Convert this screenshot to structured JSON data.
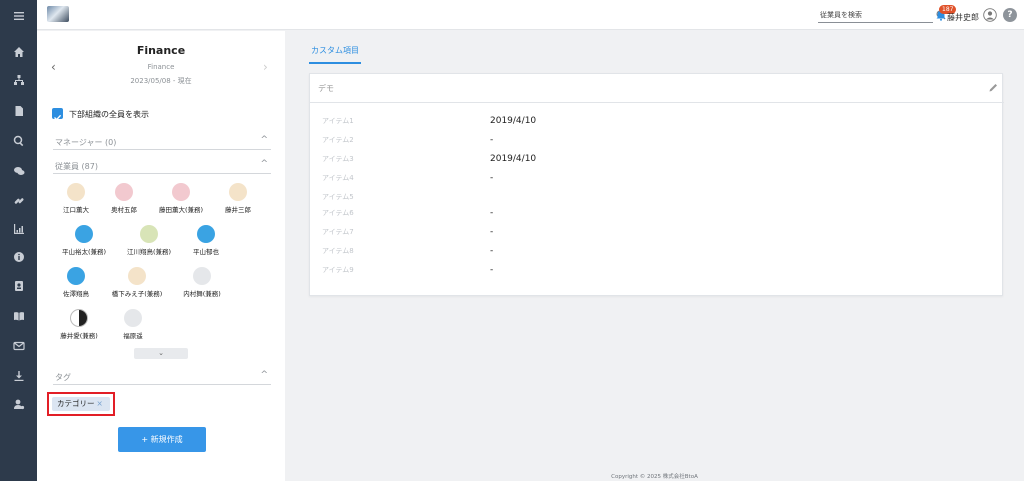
{
  "rail": {
    "icons": [
      "menu-icon",
      "home-icon",
      "org-chart-icon",
      "document-icon",
      "search-icon",
      "chat-icon",
      "link-icon",
      "chart-icon",
      "info-icon",
      "contact-card-icon",
      "book-icon",
      "mail-icon",
      "download-icon",
      "user-settings-icon"
    ]
  },
  "topbar": {
    "search_placeholder": "従業員を検索",
    "notif_count": "187",
    "username": "藤井史郎",
    "help_label": "?"
  },
  "org": {
    "title": "Finance",
    "subtitle": "Finance",
    "date": "2023/05/08 - 現在",
    "prev": "‹",
    "next": "›"
  },
  "show_all_label": "下部組織の全員を表示",
  "sections": {
    "manager": "マネージャー (0)",
    "employees": "従業員 (87)",
    "tags": "タグ",
    "chevron": "^"
  },
  "employees": [
    {
      "name": "江口薫大"
    },
    {
      "name": "奥村五郎"
    },
    {
      "name": "藤田薫大(兼務)"
    },
    {
      "name": "藤井三郎"
    },
    {
      "name": "平山裕太(兼務)"
    },
    {
      "name": "江川翔鳥(兼務)"
    },
    {
      "name": "平山郁也"
    },
    {
      "name": "佐澤翔鳥"
    },
    {
      "name": "橋下みえ子(兼務)"
    },
    {
      "name": "内村舞(兼務)"
    },
    {
      "name": "藤井愛(兼務)"
    },
    {
      "name": "福原遥"
    }
  ],
  "expand_label": "⌄",
  "tag": {
    "label": "カテゴリー",
    "remove": "×"
  },
  "new_button": "+ 新規作成",
  "main": {
    "tab": "カスタム項目",
    "card_title": "デモ",
    "items": [
      {
        "label": "アイテム1",
        "value": "2019/4/10"
      },
      {
        "label": "アイテム2",
        "value": "-"
      },
      {
        "label": "アイテム3",
        "value": "2019/4/10"
      },
      {
        "label": "アイテム4",
        "value": "-"
      },
      {
        "label": "アイテム5",
        "value": ""
      },
      {
        "label": "アイテム6",
        "value": "-"
      },
      {
        "label": "アイテム7",
        "value": "-"
      },
      {
        "label": "アイテム8",
        "value": "-"
      },
      {
        "label": "アイテム9",
        "value": "-"
      }
    ]
  },
  "footer": "Copyright © 2025 株式会社BtoA"
}
